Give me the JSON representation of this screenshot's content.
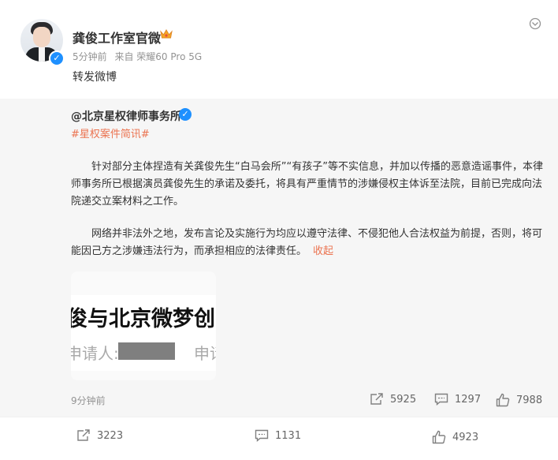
{
  "post": {
    "author": "龚俊工作室官微",
    "time": "5分钟前",
    "source": "来自 荣耀60 Pro 5G",
    "text": "转发微博",
    "verified_mark": "✓"
  },
  "quoted": {
    "author": "@北京星权律师事务所",
    "verified_mark": "✓",
    "hashtag": "#星权案件简讯#",
    "paragraph1": "针对部分主体捏造有关龚俊先生“白马会所”“有孩子”等不实信息，并加以传播的恶意造谣事件，本律师事务所已根据演员龚俊先生的承诺及委托，将具有严重情节的涉嫌侵权主体诉至法院，目前已完成向法院递交立案材料之工作。",
    "paragraph2": "网络并非法外之地，发布言论及实施行为均应以遵守法律、不侵犯他人合法权益为前提，否则，将可能因己方之涉嫌违法行为，而承担相应的法律责任。",
    "collapse_label": "收起",
    "image": {
      "line1": "俊与北京微梦创",
      "line2": "申请人:",
      "line3": "申请"
    },
    "time": "9分钟前",
    "reposts": "5925",
    "comments": "1297",
    "likes": "7988"
  },
  "bottom": {
    "reposts": "3223",
    "comments": "1131",
    "likes": "4923"
  },
  "colors": {
    "accent": "#eb7350",
    "verified": "#1e90ff",
    "quote_bg": "#f6f6f6"
  },
  "icons": [
    "more-icon",
    "crown-icon",
    "repost-icon",
    "comment-icon",
    "like-icon"
  ]
}
